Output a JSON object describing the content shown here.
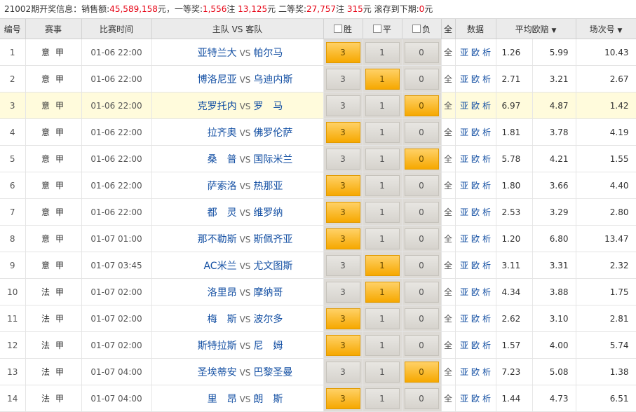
{
  "info": {
    "prefix": "21002期开奖信息：销售额:",
    "sales": "45,589,158",
    "seg1": "元，一等奖:",
    "first_count": "1,556",
    "seg2": "注 ",
    "first_amount": "13,125",
    "seg3": "元 二等奖:",
    "second_count": "27,757",
    "seg4": "注 ",
    "second_amount": "315",
    "seg5": "元 滚存到下期:",
    "rollover": "0",
    "seg6": "元"
  },
  "headers": {
    "no": "编号",
    "league": "赛事",
    "time": "比赛时间",
    "teams": "主队 VS 客队",
    "win": "胜",
    "draw": "平",
    "lose": "负",
    "all": "全",
    "data": "数据",
    "avg_odds": "平均欧赔",
    "order": "场次号"
  },
  "labels": {
    "vs": "VS",
    "all": "全",
    "ya": "亚",
    "ou": "欧",
    "xi": "析"
  },
  "rows": [
    {
      "no": "1",
      "league": "意甲",
      "time": "01-06 22:00",
      "home": "亚特兰大",
      "away": "帕尔马",
      "w": "3",
      "d": "1",
      "l": "0",
      "o1": "1.26",
      "o2": "5.99",
      "o3": "10.43",
      "sel": "w"
    },
    {
      "no": "2",
      "league": "意甲",
      "time": "01-06 22:00",
      "home": "博洛尼亚",
      "away": "乌迪内斯",
      "w": "3",
      "d": "1",
      "l": "0",
      "o1": "2.71",
      "o2": "3.21",
      "o3": "2.67",
      "sel": "d"
    },
    {
      "no": "3",
      "league": "意甲",
      "time": "01-06 22:00",
      "home": "克罗托内",
      "away": "罗　马",
      "w": "3",
      "d": "1",
      "l": "0",
      "o1": "6.97",
      "o2": "4.87",
      "o3": "1.42",
      "sel": "l"
    },
    {
      "no": "4",
      "league": "意甲",
      "time": "01-06 22:00",
      "home": "拉齐奥",
      "away": "佛罗伦萨",
      "w": "3",
      "d": "1",
      "l": "0",
      "o1": "1.81",
      "o2": "3.78",
      "o3": "4.19",
      "sel": "w"
    },
    {
      "no": "5",
      "league": "意甲",
      "time": "01-06 22:00",
      "home": "桑　普",
      "away": "国际米兰",
      "w": "3",
      "d": "1",
      "l": "0",
      "o1": "5.78",
      "o2": "4.21",
      "o3": "1.55",
      "sel": "l"
    },
    {
      "no": "6",
      "league": "意甲",
      "time": "01-06 22:00",
      "home": "萨索洛",
      "away": "热那亚",
      "w": "3",
      "d": "1",
      "l": "0",
      "o1": "1.80",
      "o2": "3.66",
      "o3": "4.40",
      "sel": "w"
    },
    {
      "no": "7",
      "league": "意甲",
      "time": "01-06 22:00",
      "home": "都　灵",
      "away": "维罗纳",
      "w": "3",
      "d": "1",
      "l": "0",
      "o1": "2.53",
      "o2": "3.29",
      "o3": "2.80",
      "sel": "w"
    },
    {
      "no": "8",
      "league": "意甲",
      "time": "01-07 01:00",
      "home": "那不勒斯",
      "away": "斯佩齐亚",
      "w": "3",
      "d": "1",
      "l": "0",
      "o1": "1.20",
      "o2": "6.80",
      "o3": "13.47",
      "sel": "w"
    },
    {
      "no": "9",
      "league": "意甲",
      "time": "01-07 03:45",
      "home": "AC米兰",
      "away": "尤文图斯",
      "w": "3",
      "d": "1",
      "l": "0",
      "o1": "3.11",
      "o2": "3.31",
      "o3": "2.32",
      "sel": "d"
    },
    {
      "no": "10",
      "league": "法甲",
      "time": "01-07 02:00",
      "home": "洛里昂",
      "away": "摩纳哥",
      "w": "3",
      "d": "1",
      "l": "0",
      "o1": "4.34",
      "o2": "3.88",
      "o3": "1.75",
      "sel": "d"
    },
    {
      "no": "11",
      "league": "法甲",
      "time": "01-07 02:00",
      "home": "梅　斯",
      "away": "波尔多",
      "w": "3",
      "d": "1",
      "l": "0",
      "o1": "2.62",
      "o2": "3.10",
      "o3": "2.81",
      "sel": "w"
    },
    {
      "no": "12",
      "league": "法甲",
      "time": "01-07 02:00",
      "home": "斯特拉斯",
      "away": "尼　姆",
      "w": "3",
      "d": "1",
      "l": "0",
      "o1": "1.57",
      "o2": "4.00",
      "o3": "5.74",
      "sel": "w"
    },
    {
      "no": "13",
      "league": "法甲",
      "time": "01-07 04:00",
      "home": "圣埃蒂安",
      "away": "巴黎圣曼",
      "w": "3",
      "d": "1",
      "l": "0",
      "o1": "7.23",
      "o2": "5.08",
      "o3": "1.38",
      "sel": "l"
    },
    {
      "no": "14",
      "league": "法甲",
      "time": "01-07 04:00",
      "home": "里　昂",
      "away": "朗　斯",
      "w": "3",
      "d": "1",
      "l": "0",
      "o1": "1.44",
      "o2": "4.73",
      "o3": "6.51",
      "sel": "w"
    }
  ]
}
